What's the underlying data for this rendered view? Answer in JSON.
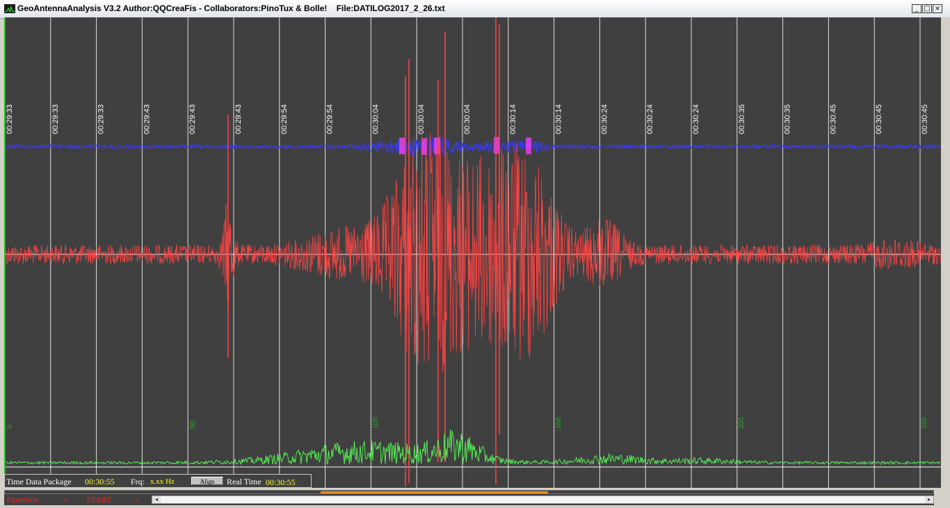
{
  "window": {
    "title": "GeoAntennaAnalysis V3.2 Author:QQCreaFis - Collaborators:PinoTux & Bolle!    File:DATILOG2017_2_26.txt",
    "minimize_glyph": "_",
    "maximize_glyph": "□",
    "close_glyph": "×"
  },
  "colors": {
    "plot_bg": "#404040",
    "grid": "#ffffff",
    "blue_trace": "#3a3aff",
    "magenta_peaks": "#ff40ff",
    "red_trace": "#ff4444",
    "green_trace": "#55ff55",
    "green_labels": "#22aa22"
  },
  "time_labels": [
    "00:29:33",
    "00:29:33",
    "00:29:33",
    "00:29:43",
    "00:29:43",
    "00:29:43",
    "00:29:54",
    "00:29:54",
    "00:30:04",
    "00:30:04",
    "00:30:04",
    "00:30:14",
    "00:30:14",
    "00:30:24",
    "00:30:24",
    "00:30:24",
    "00:30:35",
    "00:30:35",
    "00:30:45",
    "00:30:45",
    "00:30:45"
  ],
  "freq_labels": [
    "0",
    "50",
    "100",
    "150",
    "200",
    "250"
  ],
  "status": {
    "time_label": "Time Data Package",
    "time_value": "00:30:55",
    "freq_label": "Frq:",
    "freq_value": "x.xx Hz",
    "align_label": "Align",
    "real_label": "Real Time",
    "real_value": "00:30:55"
  },
  "progress": {
    "fraction_start": 0.34,
    "fraction_end": 0.585
  },
  "nav": {
    "openwin": "OpenWin",
    "prev": "<",
    "start": "START",
    "next": ">"
  }
}
